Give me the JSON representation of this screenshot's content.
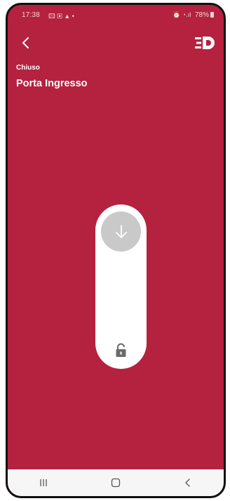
{
  "status_bar": {
    "time": "17:38",
    "left_icons": "🖾 ▣ ▲ •",
    "right_icons": "⏰ ◔.ıl",
    "battery": "78%"
  },
  "header": {
    "back_icon": "chevron-left-icon",
    "logo_icon": "brand-logo-icon"
  },
  "door": {
    "state": "Chiuso",
    "name": "Porta Ingresso"
  },
  "slider": {
    "knob_icon": "arrow-down-icon",
    "lock_icon": "lock-icon",
    "position": 0
  },
  "navbar": {
    "recent_icon": "recent-apps-icon",
    "home_icon": "home-icon",
    "back_icon": "back-icon"
  },
  "colors": {
    "background": "#b4223f",
    "slider_track": "#ffffff",
    "knob": "#c9c9c9",
    "navbar": "#f6f6f6"
  }
}
